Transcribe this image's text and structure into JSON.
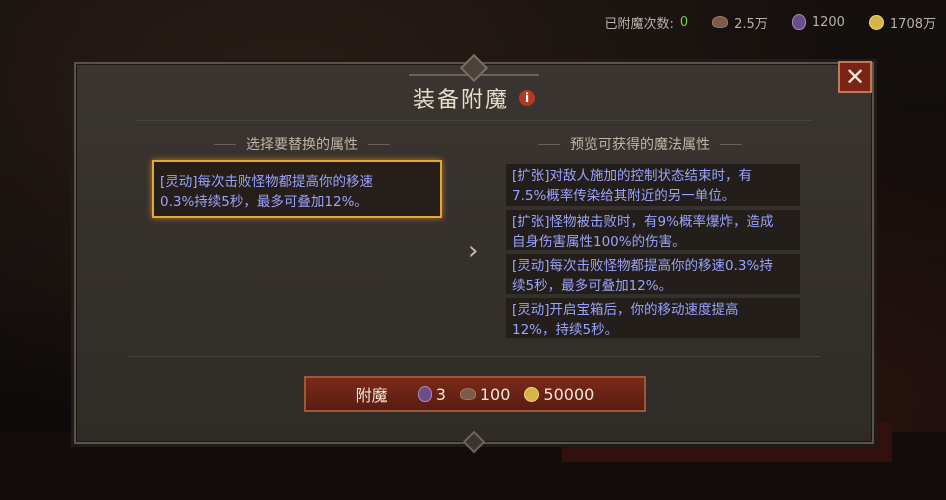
{
  "topbar": {
    "enchant_count_label": "已附魔次数:",
    "enchant_count_value": "0",
    "dust": "2.5万",
    "flask": "1200",
    "gold": "1708万"
  },
  "dialog": {
    "title": "装备附魔",
    "info_icon": "i",
    "close": "✕",
    "left_header": "选择要替换的属性",
    "right_header": "预览可获得的魔法属性",
    "selected": {
      "line1": "[灵动]每次击败怪物都提高你的移速",
      "line2": "0.3%持续5秒，最多可叠加12%。"
    },
    "arrow": "›",
    "options": [
      {
        "line1": "[扩张]对敌人施加的控制状态结束时，有",
        "line2": "7.5%概率传染给其附近的另一单位。"
      },
      {
        "line1": "[扩张]怪物被击败时，有9%概率爆炸，造成",
        "line2": "自身伤害属性100%的伤害。"
      },
      {
        "line1": "[灵动]每次击败怪物都提高你的移速0.3%持",
        "line2": "续5秒，最多可叠加12%。"
      },
      {
        "line1": "[灵动]开启宝箱后，你的移动速度提高",
        "line2": "12%，持续5秒。"
      }
    ],
    "button": {
      "label": "附魔",
      "flask_cost": "3",
      "dust_cost": "100",
      "gold_cost": "50000"
    }
  }
}
